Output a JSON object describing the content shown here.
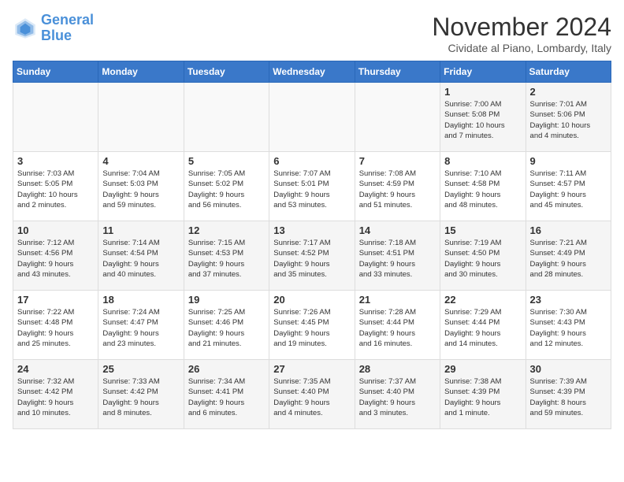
{
  "header": {
    "logo_line1": "General",
    "logo_line2": "Blue",
    "month_title": "November 2024",
    "subtitle": "Cividate al Piano, Lombardy, Italy"
  },
  "weekdays": [
    "Sunday",
    "Monday",
    "Tuesday",
    "Wednesday",
    "Thursday",
    "Friday",
    "Saturday"
  ],
  "weeks": [
    [
      {
        "day": "",
        "info": ""
      },
      {
        "day": "",
        "info": ""
      },
      {
        "day": "",
        "info": ""
      },
      {
        "day": "",
        "info": ""
      },
      {
        "day": "",
        "info": ""
      },
      {
        "day": "1",
        "info": "Sunrise: 7:00 AM\nSunset: 5:08 PM\nDaylight: 10 hours\nand 7 minutes."
      },
      {
        "day": "2",
        "info": "Sunrise: 7:01 AM\nSunset: 5:06 PM\nDaylight: 10 hours\nand 4 minutes."
      }
    ],
    [
      {
        "day": "3",
        "info": "Sunrise: 7:03 AM\nSunset: 5:05 PM\nDaylight: 10 hours\nand 2 minutes."
      },
      {
        "day": "4",
        "info": "Sunrise: 7:04 AM\nSunset: 5:03 PM\nDaylight: 9 hours\nand 59 minutes."
      },
      {
        "day": "5",
        "info": "Sunrise: 7:05 AM\nSunset: 5:02 PM\nDaylight: 9 hours\nand 56 minutes."
      },
      {
        "day": "6",
        "info": "Sunrise: 7:07 AM\nSunset: 5:01 PM\nDaylight: 9 hours\nand 53 minutes."
      },
      {
        "day": "7",
        "info": "Sunrise: 7:08 AM\nSunset: 4:59 PM\nDaylight: 9 hours\nand 51 minutes."
      },
      {
        "day": "8",
        "info": "Sunrise: 7:10 AM\nSunset: 4:58 PM\nDaylight: 9 hours\nand 48 minutes."
      },
      {
        "day": "9",
        "info": "Sunrise: 7:11 AM\nSunset: 4:57 PM\nDaylight: 9 hours\nand 45 minutes."
      }
    ],
    [
      {
        "day": "10",
        "info": "Sunrise: 7:12 AM\nSunset: 4:56 PM\nDaylight: 9 hours\nand 43 minutes."
      },
      {
        "day": "11",
        "info": "Sunrise: 7:14 AM\nSunset: 4:54 PM\nDaylight: 9 hours\nand 40 minutes."
      },
      {
        "day": "12",
        "info": "Sunrise: 7:15 AM\nSunset: 4:53 PM\nDaylight: 9 hours\nand 37 minutes."
      },
      {
        "day": "13",
        "info": "Sunrise: 7:17 AM\nSunset: 4:52 PM\nDaylight: 9 hours\nand 35 minutes."
      },
      {
        "day": "14",
        "info": "Sunrise: 7:18 AM\nSunset: 4:51 PM\nDaylight: 9 hours\nand 33 minutes."
      },
      {
        "day": "15",
        "info": "Sunrise: 7:19 AM\nSunset: 4:50 PM\nDaylight: 9 hours\nand 30 minutes."
      },
      {
        "day": "16",
        "info": "Sunrise: 7:21 AM\nSunset: 4:49 PM\nDaylight: 9 hours\nand 28 minutes."
      }
    ],
    [
      {
        "day": "17",
        "info": "Sunrise: 7:22 AM\nSunset: 4:48 PM\nDaylight: 9 hours\nand 25 minutes."
      },
      {
        "day": "18",
        "info": "Sunrise: 7:24 AM\nSunset: 4:47 PM\nDaylight: 9 hours\nand 23 minutes."
      },
      {
        "day": "19",
        "info": "Sunrise: 7:25 AM\nSunset: 4:46 PM\nDaylight: 9 hours\nand 21 minutes."
      },
      {
        "day": "20",
        "info": "Sunrise: 7:26 AM\nSunset: 4:45 PM\nDaylight: 9 hours\nand 19 minutes."
      },
      {
        "day": "21",
        "info": "Sunrise: 7:28 AM\nSunset: 4:44 PM\nDaylight: 9 hours\nand 16 minutes."
      },
      {
        "day": "22",
        "info": "Sunrise: 7:29 AM\nSunset: 4:44 PM\nDaylight: 9 hours\nand 14 minutes."
      },
      {
        "day": "23",
        "info": "Sunrise: 7:30 AM\nSunset: 4:43 PM\nDaylight: 9 hours\nand 12 minutes."
      }
    ],
    [
      {
        "day": "24",
        "info": "Sunrise: 7:32 AM\nSunset: 4:42 PM\nDaylight: 9 hours\nand 10 minutes."
      },
      {
        "day": "25",
        "info": "Sunrise: 7:33 AM\nSunset: 4:42 PM\nDaylight: 9 hours\nand 8 minutes."
      },
      {
        "day": "26",
        "info": "Sunrise: 7:34 AM\nSunset: 4:41 PM\nDaylight: 9 hours\nand 6 minutes."
      },
      {
        "day": "27",
        "info": "Sunrise: 7:35 AM\nSunset: 4:40 PM\nDaylight: 9 hours\nand 4 minutes."
      },
      {
        "day": "28",
        "info": "Sunrise: 7:37 AM\nSunset: 4:40 PM\nDaylight: 9 hours\nand 3 minutes."
      },
      {
        "day": "29",
        "info": "Sunrise: 7:38 AM\nSunset: 4:39 PM\nDaylight: 9 hours\nand 1 minute."
      },
      {
        "day": "30",
        "info": "Sunrise: 7:39 AM\nSunset: 4:39 PM\nDaylight: 8 hours\nand 59 minutes."
      }
    ]
  ]
}
